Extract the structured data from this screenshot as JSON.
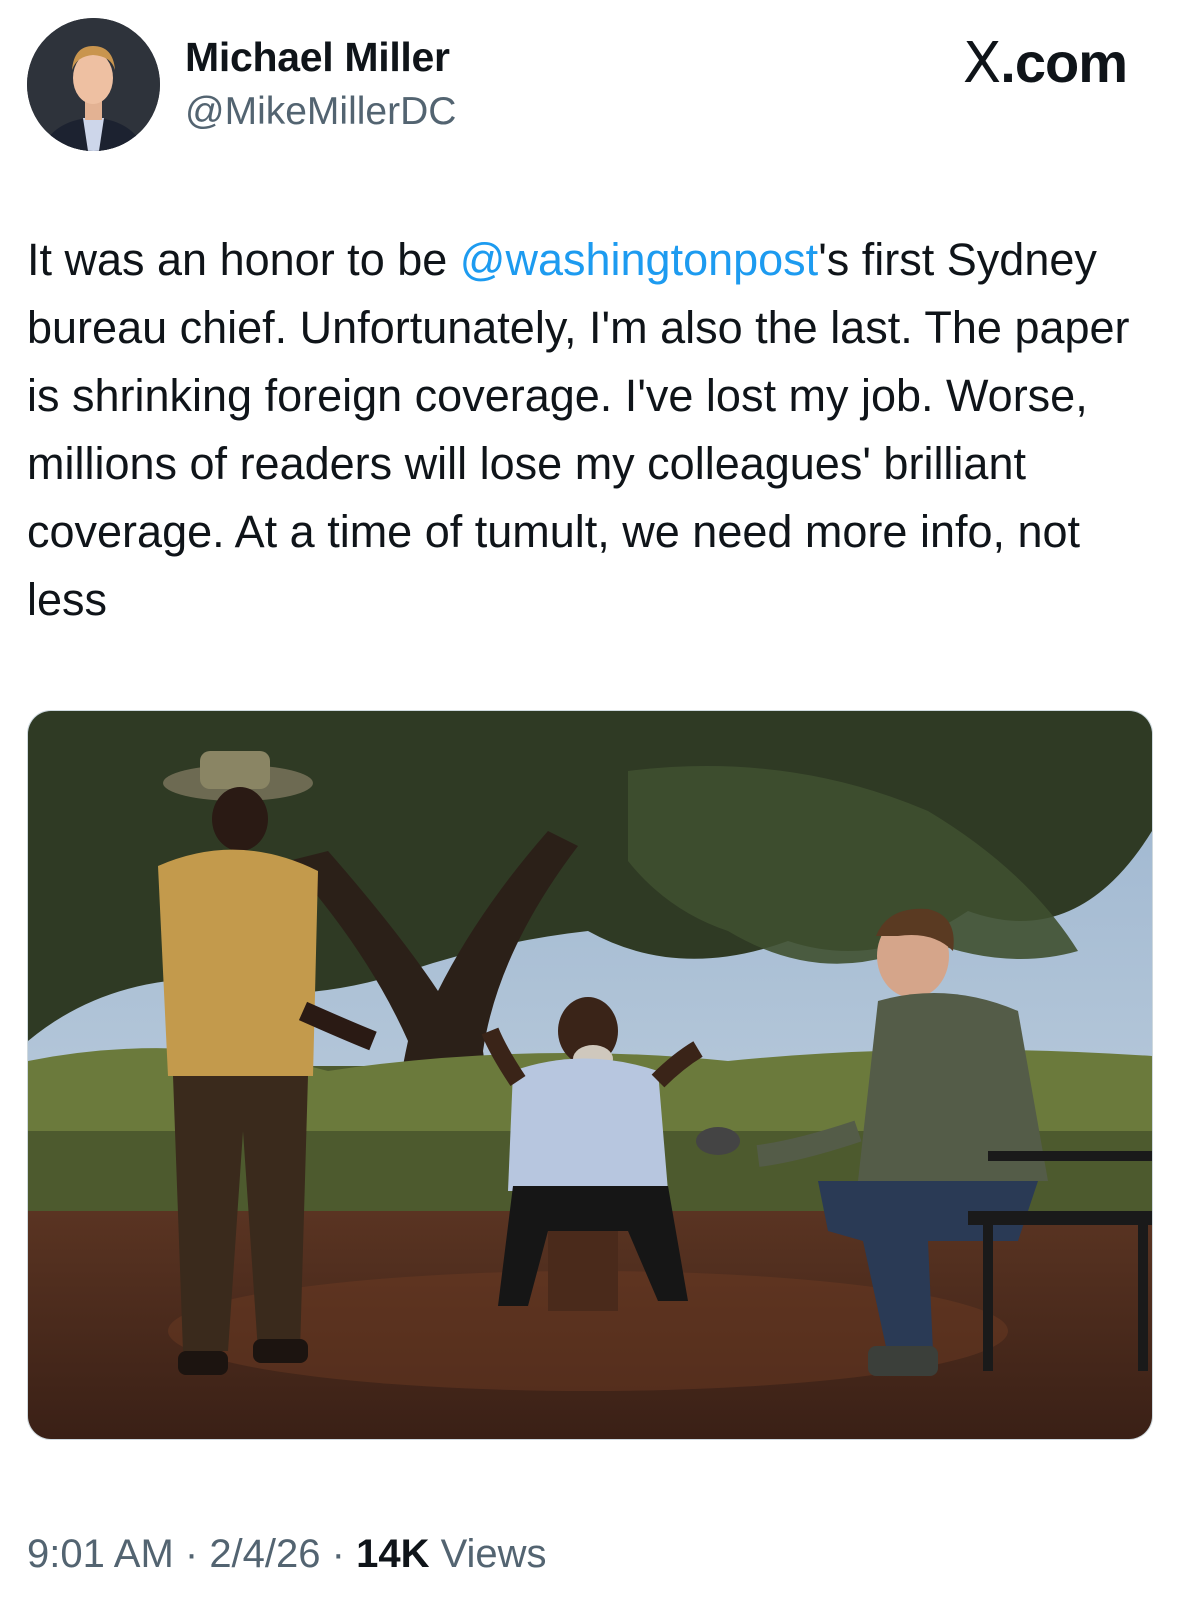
{
  "author": {
    "display_name": "Michael Miller",
    "handle": "@MikeMillerDC",
    "avatar_icon": "profile-photo"
  },
  "brand": {
    "x_glyph": "X",
    "suffix": ".com"
  },
  "tweet": {
    "text_before_mention": "It was an honor to be ",
    "mention": "@washingtonpost",
    "text_after_mention": "'s first Sydney bureau chief. Unfortunately, I'm also the last. The paper is shrinking foreign coverage. I've lost my job. Worse, millions of readers will lose my colleagues' brilliant coverage. At a time of tumult, we need more info, not less",
    "mention_color": "#1d9bf0"
  },
  "media": {
    "type": "photo",
    "icon": "tweet-photo"
  },
  "meta": {
    "time": "9:01 AM",
    "separator": " · ",
    "date": "2/4/26",
    "views_count": "14K",
    "views_label": " Views"
  }
}
